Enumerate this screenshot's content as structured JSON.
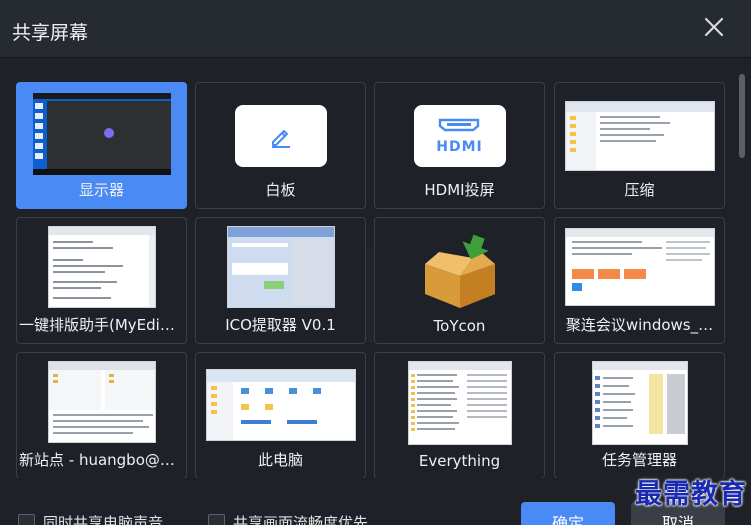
{
  "dialog": {
    "title": "共享屏幕"
  },
  "sources": [
    {
      "label": "显示器",
      "selected": true,
      "thumb": "desktop-screen"
    },
    {
      "label": "白板",
      "selected": false,
      "thumb": "pencil-icon"
    },
    {
      "label": "HDMI投屏",
      "selected": false,
      "thumb": "hdmi-icon",
      "icon_text": "HDMI"
    },
    {
      "label": "压缩",
      "selected": false,
      "thumb": "explorer-window"
    },
    {
      "label": "一键排版助手(MyEdi…",
      "selected": false,
      "thumb": "document-window"
    },
    {
      "label": "ICO提取器 V0.1",
      "selected": false,
      "thumb": "app-window"
    },
    {
      "label": "ToYcon",
      "selected": false,
      "thumb": "box-icon"
    },
    {
      "label": "聚连会议windows_…",
      "selected": false,
      "thumb": "browser-window"
    },
    {
      "label": "新站点 - huangbo@…",
      "selected": false,
      "thumb": "ftp-window"
    },
    {
      "label": "此电脑",
      "selected": false,
      "thumb": "explorer-window"
    },
    {
      "label": "Everything",
      "selected": false,
      "thumb": "list-window"
    },
    {
      "label": "任务管理器",
      "selected": false,
      "thumb": "taskmgr-window"
    }
  ],
  "options": {
    "share_audio": "同时共享电脑声音",
    "smooth_priority": "共享画面流畅度优先"
  },
  "buttons": {
    "confirm": "确定",
    "cancel": "取消"
  },
  "watermark": "最需教育",
  "colors": {
    "accent": "#4a8af5",
    "background": "#1e2127"
  }
}
